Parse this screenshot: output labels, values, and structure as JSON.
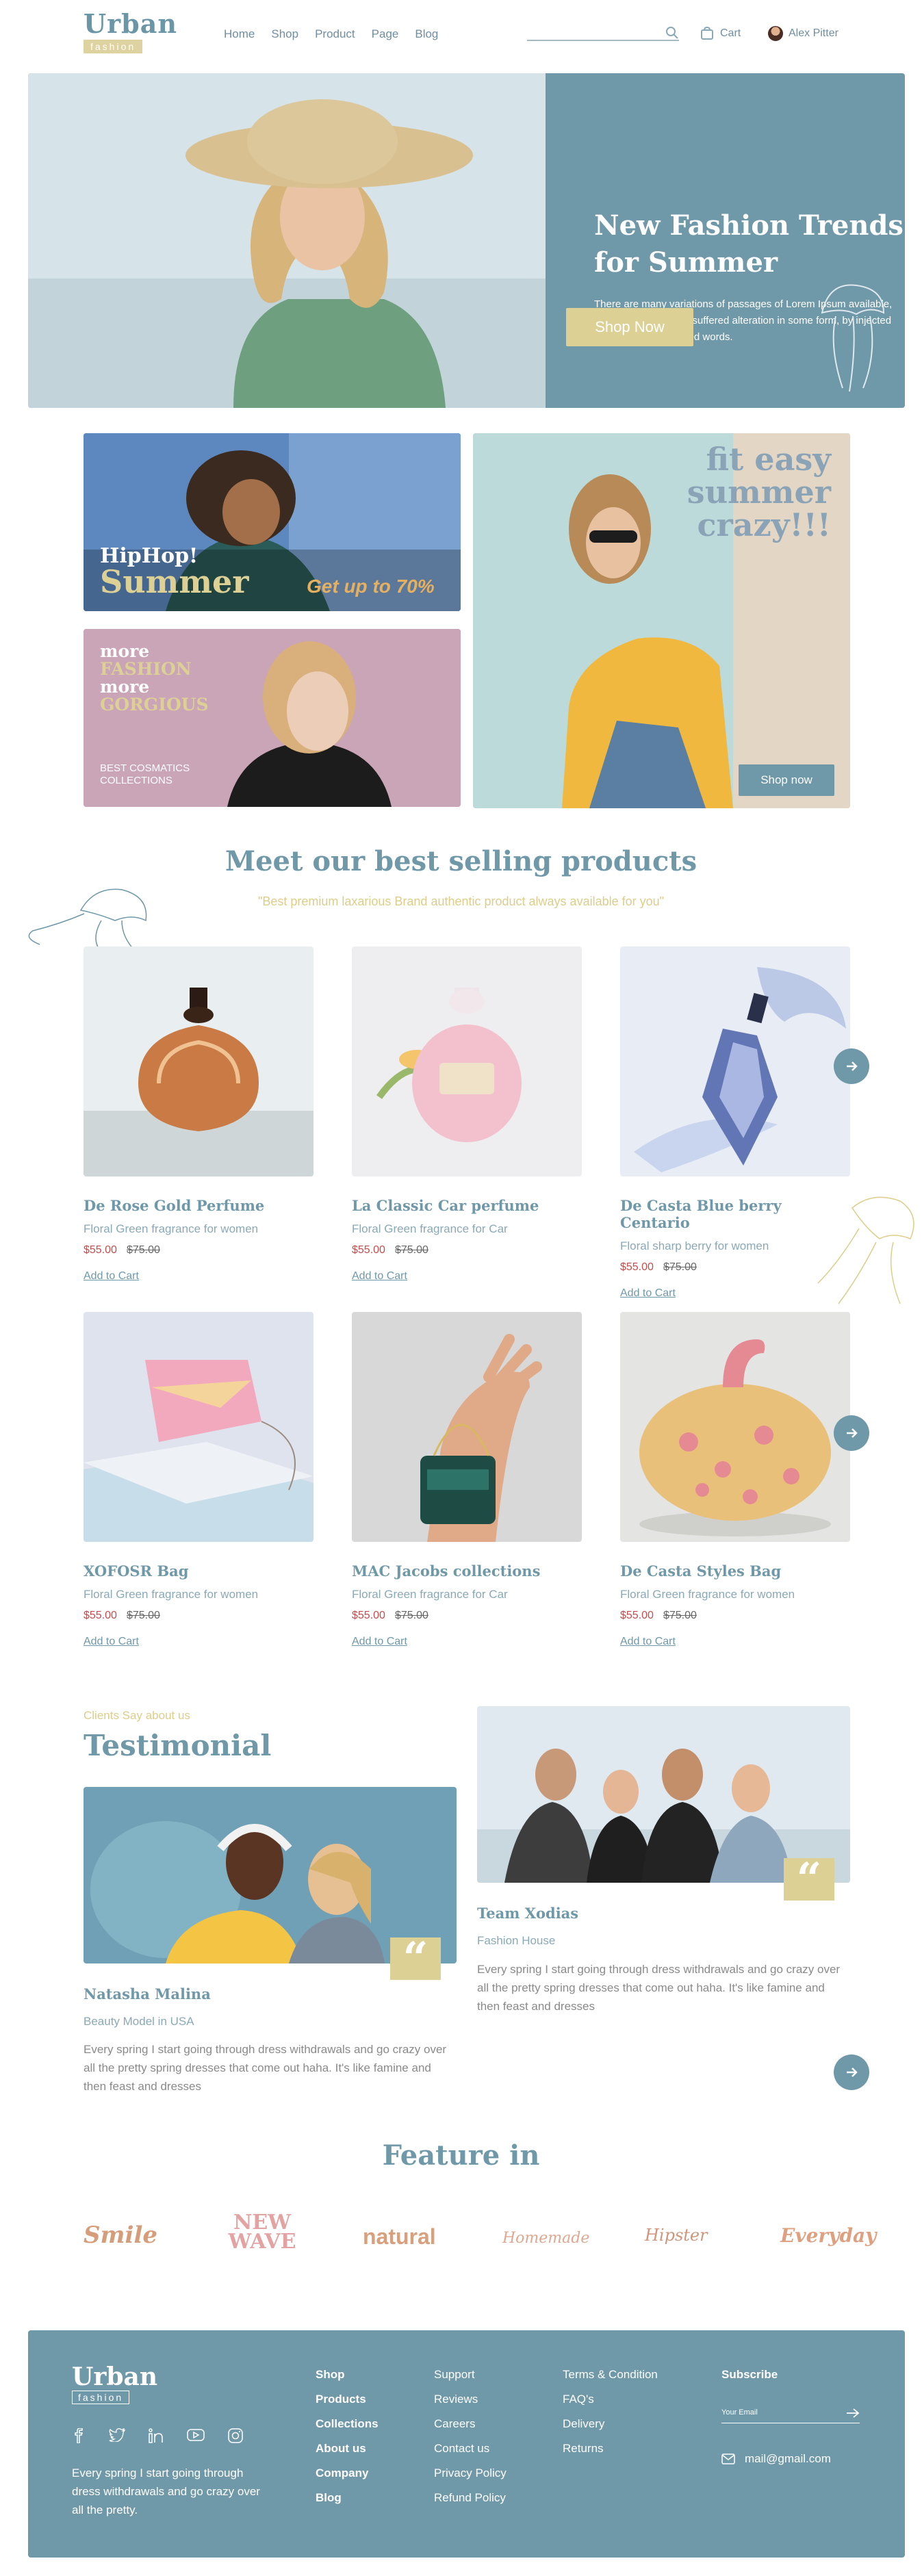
{
  "header": {
    "logo_word": "Urban",
    "logo_sub": "fashion",
    "nav": [
      "Home",
      "Shop",
      "Product",
      "Page",
      "Blog"
    ],
    "cart_label": "Cart",
    "user_name": "Alex Pitter"
  },
  "hero": {
    "title": "New Fashion Trends for Summer",
    "description": "There are many variations of passages of Lorem Ipsum available, but the majority have suffered alteration in some form, by injected humour, or randomised words.",
    "button": "Shop Now"
  },
  "promos": {
    "hiphop_line1": "HipHop!",
    "hiphop_line2": "Summer",
    "hiphop_discount": "Get up to 70%",
    "fashion_l1": "more",
    "fashion_l2": "FASHION",
    "fashion_l3": "more",
    "fashion_l4": "GORGIOUS",
    "cosmetics_l1": "BEST COSMATICS",
    "cosmetics_l2": "COLLECTIONS",
    "fit_l1": "fit easy",
    "fit_l2": "summer",
    "fit_l3": "crazy!!!",
    "fit_button": "Shop now"
  },
  "products_section": {
    "title": "Meet our best selling products",
    "subtitle": "\"Best premium laxarious Brand authentic product always available for you\"",
    "items": [
      {
        "name": "De Rose Gold Perfume",
        "desc": "Floral Green fragrance for women",
        "price": "$55.00",
        "old_price": "$75.00",
        "cta": "Add to Cart"
      },
      {
        "name": "La Classic Car perfume",
        "desc": "Floral Green fragrance for Car",
        "price": "$55.00",
        "old_price": "$75.00",
        "cta": "Add to Cart"
      },
      {
        "name": "De Casta Blue berry Centario",
        "desc": "Floral sharp berry for women",
        "price": "$55.00",
        "old_price": "$75.00",
        "cta": "Add to Cart"
      },
      {
        "name": "XOFOSR Bag",
        "desc": "Floral Green fragrance for women",
        "price": "$55.00",
        "old_price": "$75.00",
        "cta": "Add to Cart"
      },
      {
        "name": "MAC Jacobs collections",
        "desc": "Floral Green fragrance for Car",
        "price": "$55.00",
        "old_price": "$75.00",
        "cta": "Add to Cart"
      },
      {
        "name": "De Casta Styles Bag",
        "desc": "Floral Green fragrance for women",
        "price": "$55.00",
        "old_price": "$75.00",
        "cta": "Add to Cart"
      }
    ]
  },
  "testimonial": {
    "eyebrow": "Clients Say about us",
    "title": "Testimonial",
    "cards": [
      {
        "name": "Natasha Malina",
        "role": "Beauty Model in USA",
        "text": "Every spring I start going through dress withdrawals and go crazy over all the pretty spring dresses that come out haha. It's like famine and then feast and dresses"
      },
      {
        "name": "Team Xodias",
        "role": "Fashion House",
        "text": "Every spring I start going through dress withdrawals and go crazy over all the pretty spring dresses that come out haha. It's like famine and then feast and dresses"
      }
    ]
  },
  "feature": {
    "title": "Feature in",
    "brands": [
      "Smile",
      "NEW WAVE",
      "natural",
      "Homemade",
      "Hipster",
      "Everyday"
    ]
  },
  "footer": {
    "logo_word": "Urban",
    "logo_sub": "fashion",
    "about": "Every spring I start going through dress withdrawals and go crazy over all the pretty.",
    "col1": [
      "Shop",
      "Products",
      "Collections",
      "About us",
      "Company",
      "Blog"
    ],
    "col2": [
      "Support",
      "Reviews",
      "Careers",
      "Contact us",
      "Privacy Policy",
      "Refund Policy"
    ],
    "col3": [
      "Terms & Condition",
      "FAQ's",
      "Delivery",
      "Returns"
    ],
    "subscribe_title": "Subscribe",
    "email_placeholder": "Your Email",
    "email": "mail@gmail.com"
  },
  "colors": {
    "accent": "#6f98a8",
    "gold": "#ddd094",
    "price": "#c24d4d"
  }
}
